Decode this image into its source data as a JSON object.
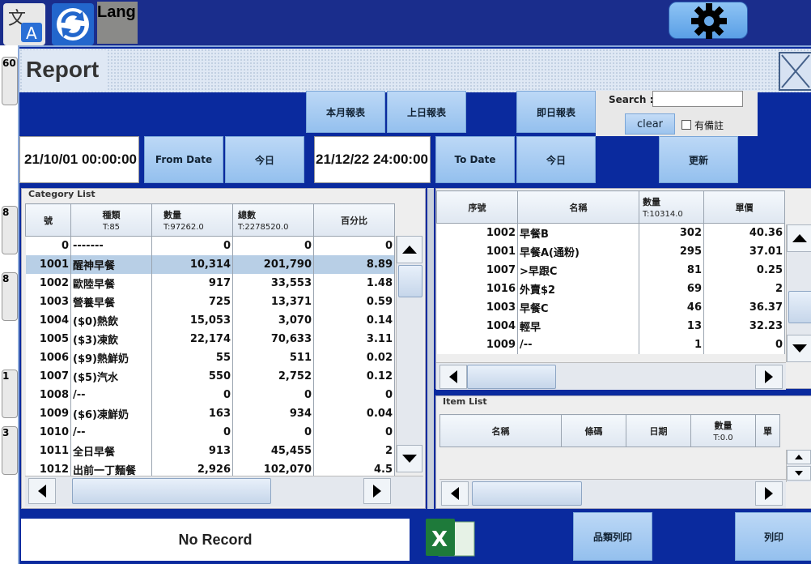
{
  "top": {
    "lang_label": "Lang"
  },
  "window": {
    "title": "Report",
    "buttons": {
      "this_month": "本月報表",
      "last_month": "上日報表",
      "today_report": "即日報表",
      "from_date": "From Date",
      "from_today": "今日",
      "to_date": "To Date",
      "to_today": "今日",
      "refresh": "更新"
    },
    "search": {
      "label": "Search :",
      "value": "",
      "clear": "clear",
      "remark_label": "有備註"
    },
    "dates": {
      "from": "21/10/01 00:00:00",
      "to": "21/12/22 24:00:00"
    },
    "left_stubs": [
      "60",
      "8",
      "8",
      "1",
      "3"
    ]
  },
  "category_list": {
    "title": "Category List",
    "headers": [
      {
        "label": "號",
        "sub": ""
      },
      {
        "label": "種類",
        "sub": "T:85"
      },
      {
        "label": "數量",
        "sub": "T:97262.0"
      },
      {
        "label": "總數",
        "sub": "T:2278520.0"
      },
      {
        "label": "百分比",
        "sub": ""
      }
    ],
    "rows": [
      [
        "0",
        "-------",
        "0",
        "0",
        "0"
      ],
      [
        "1001",
        "醒神早餐",
        "10,314",
        "201,790",
        "8.89"
      ],
      [
        "1002",
        "歐陸早餐",
        "917",
        "33,553",
        "1.48"
      ],
      [
        "1003",
        "營養早餐",
        "725",
        "13,371",
        "0.59"
      ],
      [
        "1004",
        "($0)熱飲",
        "15,053",
        "3,070",
        "0.14"
      ],
      [
        "1005",
        "($3)凍飲",
        "22,174",
        "70,633",
        "3.11"
      ],
      [
        "1006",
        "($9)熱鮮奶",
        "55",
        "511",
        "0.02"
      ],
      [
        "1007",
        "($5)汽水",
        "550",
        "2,752",
        "0.12"
      ],
      [
        "1008",
        "/--",
        "0",
        "0",
        "0"
      ],
      [
        "1009",
        "($6)凍鮮奶",
        "163",
        "934",
        "0.04"
      ],
      [
        "1010",
        "/--",
        "0",
        "0",
        "0"
      ],
      [
        "1011",
        "全日早餐",
        "913",
        "45,455",
        "2"
      ],
      [
        "1012",
        "出前一丁麵餐",
        "2,926",
        "102,070",
        "4.5"
      ]
    ]
  },
  "detail_list": {
    "headers": [
      {
        "label": "序號",
        "sub": ""
      },
      {
        "label": "名稱",
        "sub": ""
      },
      {
        "label": "數量",
        "sub": "T:10314.0"
      },
      {
        "label": "單價",
        "sub": ""
      }
    ],
    "rows": [
      [
        "1002",
        "早餐B",
        "302",
        "40.36"
      ],
      [
        "1001",
        "早餐A(通粉)",
        "295",
        "37.01"
      ],
      [
        "1007",
        ">早跟C",
        "81",
        "0.25"
      ],
      [
        "1016",
        "外賣$2",
        "69",
        "2"
      ],
      [
        "1003",
        "早餐C",
        "46",
        "36.37"
      ],
      [
        "1004",
        "輕早",
        "13",
        "32.23"
      ],
      [
        "1009",
        "/--",
        "1",
        "0"
      ]
    ]
  },
  "item_list": {
    "title": "Item List",
    "headers": [
      {
        "label": "名稱",
        "sub": ""
      },
      {
        "label": "條碼",
        "sub": ""
      },
      {
        "label": "日期",
        "sub": ""
      },
      {
        "label": "數量",
        "sub": "T:0.0"
      },
      {
        "label": "單",
        "sub": ""
      }
    ]
  },
  "footer": {
    "status": "No Record",
    "print_category": "品類列印",
    "print": "列印",
    "excel_icon": "excel-icon",
    "excel_label": "X"
  },
  "colors": {
    "background": "#1a2d8c",
    "window": "#0a2a9e",
    "selected_row": "#b8cfe6",
    "button": "#a9ccf2"
  }
}
